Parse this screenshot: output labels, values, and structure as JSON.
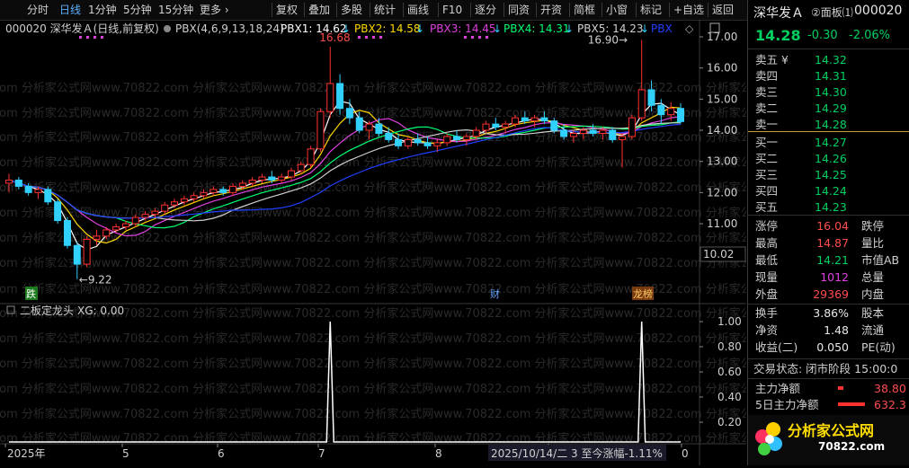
{
  "toolbar": {
    "left_items": [
      "分时",
      "日线",
      "1分钟",
      "5分钟",
      "15分钟",
      "更多 ›"
    ],
    "active": "日线",
    "right_items": [
      "复权",
      "叠加",
      "多股",
      "统计",
      "画线",
      "F10",
      "逐分",
      "同资",
      "开资",
      "简框",
      "小窗",
      "标记",
      "+自选",
      "返回"
    ]
  },
  "legend": {
    "code_name": "000020 深华发Ａ(日线,前复权)",
    "indicator": "PBX(4,6,9,13,18,24)",
    "pbx1": "PBX1: 14.62",
    "pbx2": "PBX2: 14.58",
    "pbx3": "PBX3: 14.45",
    "pbx4": "PBX4: 14.31",
    "pbx5": "PBX5: 14.23",
    "pbx6": "PBX"
  },
  "colors": {
    "pbx1": "#ffffff",
    "pbx2": "#ffd700",
    "pbx3": "#e040e0",
    "pbx4": "#00ff70",
    "pbx5": "#d0d0d0",
    "pbx6": "#2040ff",
    "up": "#ff3030",
    "down": "#30d0ff"
  },
  "price_axis": [
    "17.00",
    "16.00",
    "15.00",
    "14.00",
    "13.00",
    "12.00",
    "11.00",
    "10.02"
  ],
  "annotations": {
    "high_label": "16.68",
    "low_label": "←9.22",
    "recent_high": "16.90→"
  },
  "events": {
    "fall": "跌",
    "fin": "财",
    "lhb": "龙榜"
  },
  "watermark": "com 分析家公式网www.70822.com 分析家公式网www.70822.com 分析家公式网www.70822.com 分析家公式网www.70822.com 分析家公式网www.70822.com 分析家",
  "sub_indicator": {
    "title": "二板定龙头",
    "xg": "XG: 0.00"
  },
  "sub_axis": [
    "1.00",
    "0.80",
    "0.60",
    "0.40",
    "0.20"
  ],
  "date_axis": [
    "2025年",
    "5",
    "6",
    "7",
    "8",
    "9",
    "0"
  ],
  "status_date": "2025/10/14/二 3 至今涨幅-1.11%",
  "chart_data": {
    "type": "candlestick",
    "ylim": [
      9.0,
      17.3
    ],
    "sub_ylim": [
      0,
      1.05
    ],
    "candles": [
      [
        12.3,
        12.6,
        12.0,
        12.4
      ],
      [
        12.4,
        12.5,
        12.1,
        12.2
      ],
      [
        12.2,
        12.3,
        11.9,
        12.0
      ],
      [
        12.0,
        12.2,
        11.8,
        12.1
      ],
      [
        12.1,
        12.2,
        11.6,
        11.7
      ],
      [
        11.7,
        11.8,
        11.0,
        11.1
      ],
      [
        11.1,
        11.2,
        10.2,
        10.3
      ],
      [
        10.3,
        10.4,
        9.22,
        9.7
      ],
      [
        9.7,
        10.6,
        9.6,
        10.5
      ],
      [
        10.5,
        10.8,
        10.3,
        10.6
      ],
      [
        10.6,
        10.9,
        10.5,
        10.8
      ],
      [
        10.8,
        11.0,
        10.7,
        10.9
      ],
      [
        10.9,
        11.1,
        10.8,
        11.0
      ],
      [
        11.0,
        11.3,
        10.9,
        11.2
      ],
      [
        11.2,
        11.4,
        11.1,
        11.3
      ],
      [
        11.3,
        11.5,
        11.2,
        11.4
      ],
      [
        11.4,
        11.7,
        11.3,
        11.6
      ],
      [
        11.6,
        11.8,
        11.5,
        11.7
      ],
      [
        11.7,
        11.9,
        11.6,
        11.8
      ],
      [
        11.8,
        12.0,
        11.7,
        11.9
      ],
      [
        11.9,
        12.1,
        11.8,
        12.0
      ],
      [
        12.0,
        12.2,
        11.9,
        12.1
      ],
      [
        12.1,
        12.2,
        11.9,
        12.0
      ],
      [
        12.0,
        12.3,
        11.9,
        12.2
      ],
      [
        12.2,
        12.4,
        12.1,
        12.3
      ],
      [
        12.3,
        12.5,
        12.2,
        12.4
      ],
      [
        12.4,
        12.6,
        12.3,
        12.5
      ],
      [
        12.5,
        12.7,
        12.3,
        12.4
      ],
      [
        12.4,
        12.6,
        12.3,
        12.5
      ],
      [
        12.5,
        12.8,
        12.4,
        12.7
      ],
      [
        12.7,
        13.0,
        12.6,
        12.9
      ],
      [
        12.9,
        13.5,
        12.8,
        13.4
      ],
      [
        13.4,
        14.7,
        13.3,
        14.6
      ],
      [
        14.6,
        16.68,
        14.4,
        15.5
      ],
      [
        15.5,
        15.8,
        14.5,
        14.7
      ],
      [
        14.7,
        15.0,
        14.2,
        14.4
      ],
      [
        14.4,
        14.6,
        13.9,
        14.0
      ],
      [
        14.0,
        14.3,
        13.7,
        14.2
      ],
      [
        14.2,
        14.4,
        13.8,
        13.9
      ],
      [
        13.9,
        14.1,
        13.6,
        13.7
      ],
      [
        13.7,
        13.9,
        13.4,
        13.5
      ],
      [
        13.5,
        13.8,
        13.4,
        13.7
      ],
      [
        13.7,
        13.9,
        13.5,
        13.6
      ],
      [
        13.6,
        13.8,
        13.4,
        13.5
      ],
      [
        13.5,
        13.7,
        13.3,
        13.6
      ],
      [
        13.6,
        13.9,
        13.5,
        13.8
      ],
      [
        13.8,
        14.0,
        13.6,
        13.7
      ],
      [
        13.7,
        13.9,
        13.5,
        13.8
      ],
      [
        13.8,
        14.1,
        13.7,
        14.0
      ],
      [
        14.0,
        14.3,
        13.9,
        14.2
      ],
      [
        14.2,
        14.4,
        14.0,
        14.1
      ],
      [
        14.1,
        14.3,
        13.9,
        14.2
      ],
      [
        14.2,
        14.5,
        14.1,
        14.4
      ],
      [
        14.4,
        14.6,
        14.2,
        14.3
      ],
      [
        14.3,
        14.5,
        14.1,
        14.4
      ],
      [
        14.4,
        14.6,
        14.2,
        14.3
      ],
      [
        14.3,
        14.4,
        13.9,
        14.0
      ],
      [
        14.0,
        14.2,
        13.7,
        13.8
      ],
      [
        13.8,
        14.0,
        13.6,
        13.9
      ],
      [
        13.9,
        14.1,
        13.7,
        14.0
      ],
      [
        14.0,
        14.2,
        13.8,
        13.9
      ],
      [
        13.9,
        14.1,
        13.7,
        14.0
      ],
      [
        14.0,
        14.1,
        13.6,
        13.7
      ],
      [
        13.7,
        13.9,
        12.8,
        13.8
      ],
      [
        13.8,
        14.5,
        13.7,
        14.4
      ],
      [
        14.4,
        16.9,
        14.3,
        15.3
      ],
      [
        15.3,
        15.6,
        14.6,
        14.8
      ],
      [
        14.8,
        15.0,
        14.2,
        14.5
      ],
      [
        14.5,
        14.9,
        14.3,
        14.7
      ],
      [
        14.7,
        14.87,
        14.21,
        14.28
      ]
    ],
    "signals": [
      0,
      0,
      0,
      0,
      0,
      0,
      0,
      0,
      0,
      0,
      0,
      0,
      0,
      0,
      0,
      0,
      0,
      0,
      0,
      0,
      0,
      0,
      0,
      0,
      0,
      0,
      0,
      0,
      0,
      0,
      0,
      0,
      0,
      1,
      0,
      0,
      0,
      0,
      0,
      0,
      0,
      0,
      0,
      0,
      0,
      0,
      0,
      0,
      0,
      0,
      0,
      0,
      0,
      0,
      0,
      0,
      0,
      0,
      0,
      0,
      0,
      0,
      0,
      0,
      0,
      1,
      0,
      0,
      0,
      0
    ]
  },
  "panel": {
    "title": "深华发Ａ",
    "board": "②面板⑴",
    "code": "000020",
    "price": "14.28",
    "change": "-0.30",
    "pct": "-2.06%",
    "asks": [
      {
        "label": "卖五 ¥",
        "price": "14.32"
      },
      {
        "label": "卖四",
        "price": "14.31"
      },
      {
        "label": "卖三",
        "price": "14.30"
      },
      {
        "label": "卖二",
        "price": "14.29"
      },
      {
        "label": "卖一",
        "price": "14.28"
      }
    ],
    "bids": [
      {
        "label": "买一",
        "price": "14.27"
      },
      {
        "label": "买二",
        "price": "14.26"
      },
      {
        "label": "买三",
        "price": "14.25"
      },
      {
        "label": "买四",
        "price": "14.24"
      },
      {
        "label": "买五",
        "price": "14.23"
      }
    ],
    "stats1": [
      {
        "l": "涨停",
        "v": "16.04",
        "r": "跌停"
      },
      {
        "l": "最高",
        "v": "14.87",
        "r": "量比"
      },
      {
        "l": "最低",
        "v": "14.21",
        "r": "市值AB"
      },
      {
        "l": "现量",
        "v": "1012",
        "r": "总量"
      },
      {
        "l": "外盘",
        "v": "29369",
        "r": "内盘"
      }
    ],
    "stats2": [
      {
        "l": "换手",
        "v": "3.86%",
        "r": "股本"
      },
      {
        "l": "净资",
        "v": "1.48",
        "r": "流通"
      },
      {
        "l": "收益(二)",
        "v": "0.050",
        "r": "PE(动)"
      }
    ],
    "trade_state": "交易状态: 闭市阶段 15:00:0",
    "main_flow": {
      "label": "主力净额",
      "value": "38.80"
    },
    "flow5": {
      "label": "5日主力净额",
      "value": "632.3"
    },
    "logo_text": "分析家公式网",
    "logo_url": "70822.com"
  }
}
